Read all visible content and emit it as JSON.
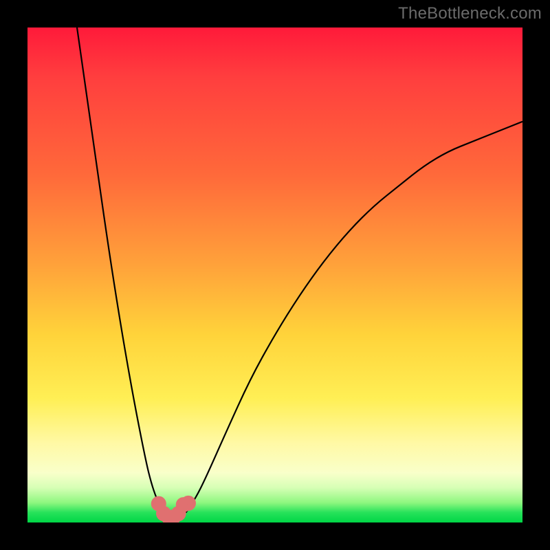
{
  "watermark": "TheBottleneck.com",
  "chart_data": {
    "type": "line",
    "title": "",
    "xlabel": "",
    "ylabel": "",
    "xlim": [
      0,
      100
    ],
    "ylim": [
      0,
      100
    ],
    "grid": false,
    "legend": false,
    "background_gradient": {
      "direction": "vertical",
      "stops": [
        {
          "pos": 0,
          "color": "#ff1a3a"
        },
        {
          "pos": 30,
          "color": "#ff6a3a"
        },
        {
          "pos": 60,
          "color": "#ffd33a"
        },
        {
          "pos": 85,
          "color": "#fff9a5"
        },
        {
          "pos": 100,
          "color": "#00d646"
        }
      ]
    },
    "series": [
      {
        "name": "left-branch",
        "color": "#000000",
        "x": [
          10,
          12,
          14,
          16,
          18,
          20,
          22,
          24,
          25,
          26,
          27,
          28
        ],
        "values": [
          100,
          86,
          72,
          58,
          45,
          33,
          22,
          12,
          8,
          5,
          3,
          2
        ]
      },
      {
        "name": "right-branch",
        "color": "#000000",
        "x": [
          32,
          34,
          36,
          40,
          45,
          50,
          55,
          60,
          65,
          70,
          75,
          80,
          85,
          90,
          95,
          100
        ],
        "values": [
          2,
          5,
          9,
          18,
          29,
          38,
          46,
          53,
          59,
          64,
          68,
          72,
          75,
          77,
          79,
          81
        ]
      },
      {
        "name": "notch",
        "color": "#e07070",
        "thick": true,
        "x": [
          26.5,
          27,
          27.5,
          28,
          28.5,
          29,
          29.5,
          30,
          30.5,
          31,
          31.5,
          32,
          32.5
        ],
        "values": [
          3.8,
          2.6,
          1.8,
          1.3,
          1.1,
          1.0,
          1.1,
          1.3,
          1.8,
          2.6,
          3.6,
          3.8,
          3.9
        ]
      }
    ]
  }
}
